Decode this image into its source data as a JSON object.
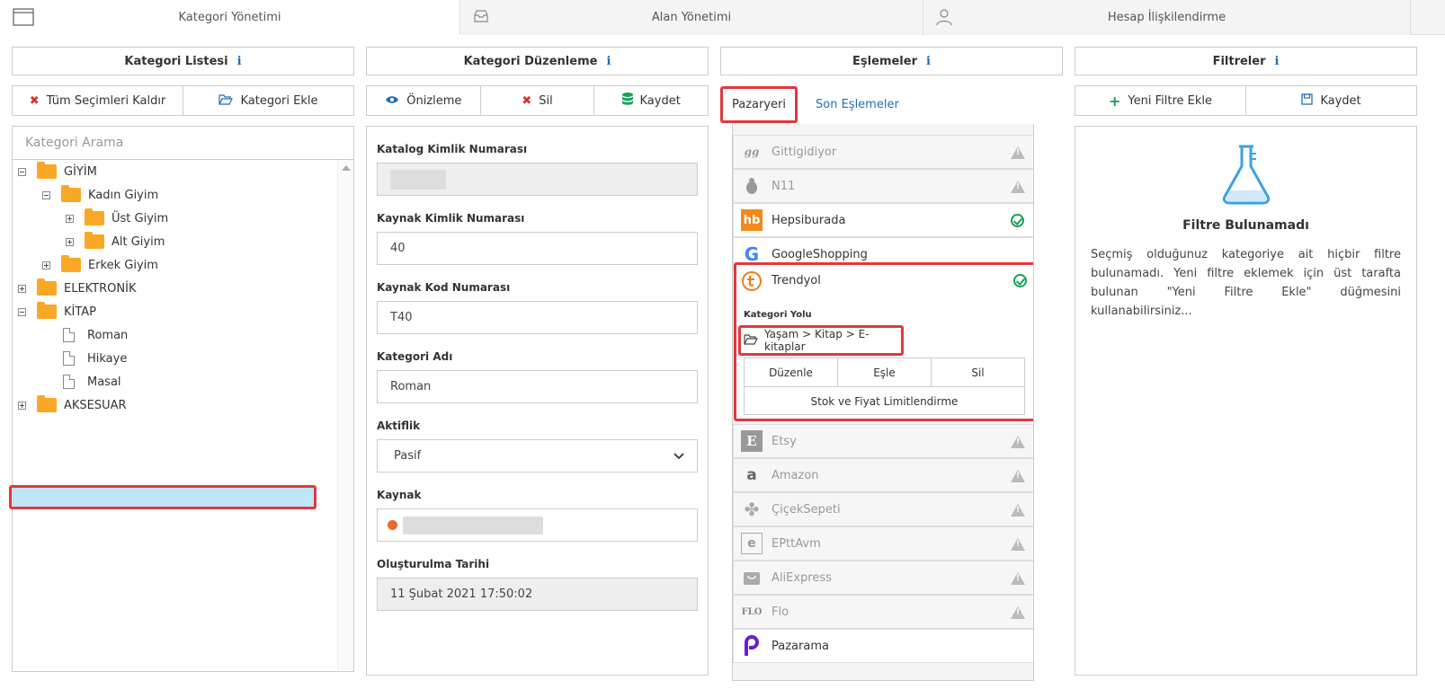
{
  "tabs": [
    {
      "label": "Kategori Yönetimi",
      "icon": "window-icon"
    },
    {
      "label": "Alan Yönetimi",
      "icon": "inbox-icon"
    },
    {
      "label": "Hesap İlişkilendirme",
      "icon": "user-icon"
    }
  ],
  "col1": {
    "title": "Kategori Listesi",
    "clear_label": "Tüm Seçimleri Kaldır",
    "add_label": "Kategori Ekle",
    "search_placeholder": "Kategori Arama",
    "tree": [
      {
        "label": "GİYİM",
        "type": "folder",
        "state": "expanded",
        "level": 0
      },
      {
        "label": "Kadın Giyim",
        "type": "folder",
        "state": "expanded",
        "level": 1
      },
      {
        "label": "Üst Giyim",
        "type": "folder",
        "state": "collapsed",
        "level": 2
      },
      {
        "label": "Alt Giyim",
        "type": "folder",
        "state": "collapsed",
        "level": 2
      },
      {
        "label": "Erkek Giyim",
        "type": "folder",
        "state": "collapsed",
        "level": 1
      },
      {
        "label": "ELEKTRONİK",
        "type": "folder",
        "state": "collapsed",
        "level": 0
      },
      {
        "label": "KİTAP",
        "type": "folder",
        "state": "expanded",
        "level": 0
      },
      {
        "label": "Roman",
        "type": "file",
        "level": 1,
        "selected": true
      },
      {
        "label": "Hikaye",
        "type": "file",
        "level": 1
      },
      {
        "label": "Masal",
        "type": "file",
        "level": 1
      },
      {
        "label": "AKSESUAR",
        "type": "folder",
        "state": "collapsed",
        "level": 0
      }
    ]
  },
  "col2": {
    "title": "Kategori Düzenleme",
    "preview_label": "Önizleme",
    "delete_label": "Sil",
    "save_label": "Kaydet",
    "fields": {
      "catalog_id_label": "Katalog Kimlik Numarası",
      "source_id_label": "Kaynak Kimlik Numarası",
      "source_id_value": "40",
      "source_code_label": "Kaynak Kod Numarası",
      "source_code_value": "T40",
      "name_label": "Kategori Adı",
      "name_value": "Roman",
      "active_label": "Aktiflik",
      "active_value": "Pasif",
      "source_label": "Kaynak",
      "created_label": "Oluşturulma Tarihi",
      "created_value": "11 Şubat 2021 17:50:02"
    }
  },
  "col3": {
    "title": "Eşlemeler",
    "tab_marketplace": "Pazaryeri",
    "tab_recent": "Son Eşlemeler",
    "markets": [
      {
        "name": "Gittigidiyor",
        "status": "warning"
      },
      {
        "name": "N11",
        "status": "warning"
      },
      {
        "name": "Hepsiburada",
        "status": "ok"
      },
      {
        "name": "GoogleShopping",
        "status": "none"
      },
      {
        "name": "Trendyol",
        "status": "ok"
      },
      {
        "name": "Etsy",
        "status": "warning"
      },
      {
        "name": "Amazon",
        "status": "warning"
      },
      {
        "name": "ÇiçekSepeti",
        "status": "warning"
      },
      {
        "name": "EPttAvm",
        "status": "warning"
      },
      {
        "name": "AliExpress",
        "status": "warning"
      },
      {
        "name": "Flo",
        "status": "warning"
      },
      {
        "name": "Pazarama",
        "status": "none"
      }
    ],
    "expanded": {
      "path_label": "Kategori Yolu",
      "path_value": "Yaşam > Kitap > E-kitaplar",
      "edit_label": "Düzenle",
      "map_label": "Eşle",
      "delete_label": "Sil",
      "limit_label": "Stok ve Fiyat Limitlendirme"
    }
  },
  "col4": {
    "title": "Filtreler",
    "add_label": "Yeni Filtre Ekle",
    "save_label": "Kaydet",
    "empty_title": "Filtre Bulunamadı",
    "empty_text": "Seçmiş olduğunuz kategoriye ait hiçbir filtre bulunamadı. Yeni filtre eklemek için üst tarafta bulunan \"Yeni Filtre Ekle\" düğmesini kullanabilirsiniz..."
  },
  "colors": {
    "accent": "#1f6fb8",
    "highlight": "#e0383e",
    "selected_bg": "#bfe6f8",
    "ok": "#17a05a",
    "folder": "#f9a825"
  }
}
